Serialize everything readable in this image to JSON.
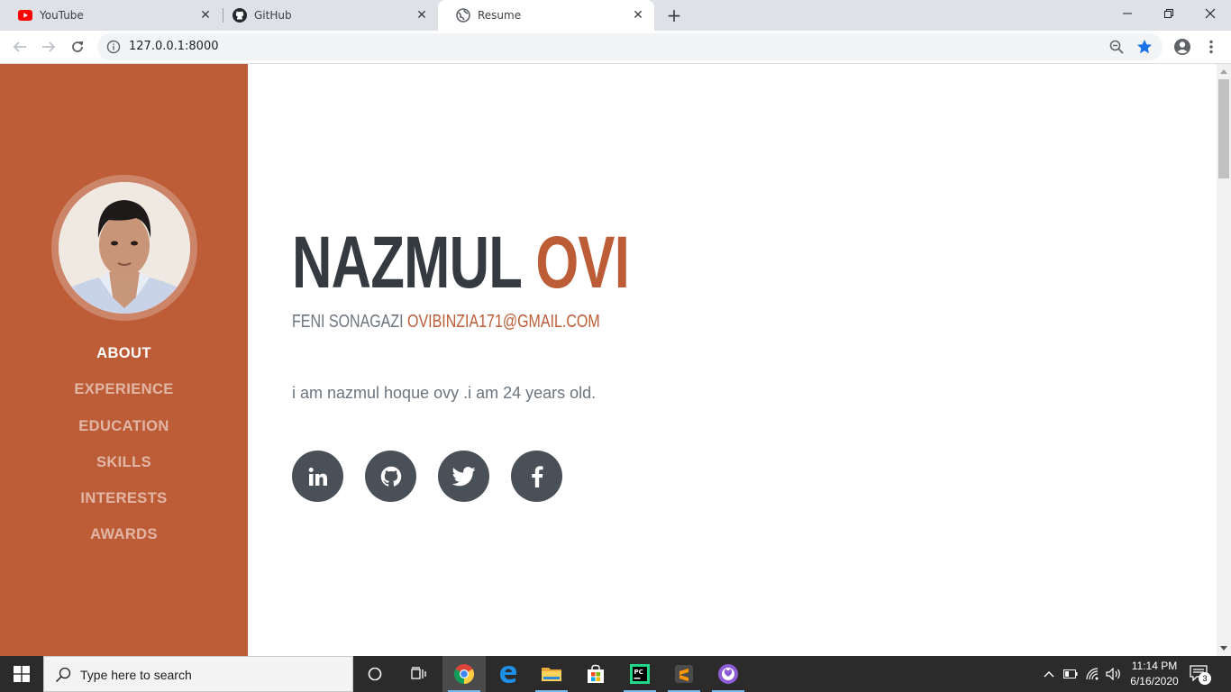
{
  "browser": {
    "tabs": [
      {
        "title": "YouTube",
        "icon": "youtube-icon",
        "active": false
      },
      {
        "title": "GitHub",
        "icon": "github-icon",
        "active": false
      },
      {
        "title": "Resume",
        "icon": "globe-icon",
        "active": true
      }
    ],
    "url": "127.0.0.1:8000",
    "bookmark_color": "#1a73e8"
  },
  "sidebar": {
    "bg_color": "#bd5d38",
    "avatar": "profile-photo",
    "nav": [
      "ABOUT",
      "EXPERIENCE",
      "EDUCATION",
      "SKILLS",
      "INTERESTS",
      "AWARDS"
    ],
    "active_index": 0
  },
  "about": {
    "first_name": "NAZMUL",
    "last_name": "OVI",
    "location": "FENI SONAGAZI",
    "email": "OVIBINZIA171@GMAIL.COM",
    "bio": "i am nazmul hoque ovy .i am 24 years old.",
    "socials": [
      "linkedin-icon",
      "github-icon",
      "twitter-icon",
      "facebook-icon"
    ],
    "accent_color": "#bd5d38"
  },
  "taskbar": {
    "search_placeholder": "Type here to search",
    "apps": [
      "cortana-icon",
      "task-view-icon",
      "chrome-icon",
      "edge-icon",
      "file-explorer-icon",
      "store-icon",
      "pycharm-icon",
      "sublime-icon",
      "github-desktop-icon"
    ],
    "time": "11:14 PM",
    "date": "6/16/2020",
    "notification_count": "3"
  }
}
